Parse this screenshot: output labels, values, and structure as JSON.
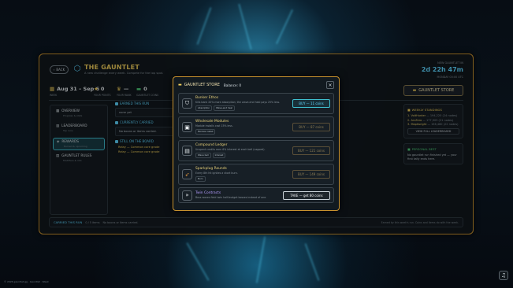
{
  "header": {
    "back_label": "BACK",
    "title": "THE GAUNTLET",
    "subtitle": "A new challenge every week. Compete for the top spot."
  },
  "next": {
    "label": "NEW GAUNTLET IN",
    "countdown": "2d 22h 47m",
    "sub": "MONDAY 00:00 UTC"
  },
  "stats": [
    {
      "value": "Aug 31 – Sep 6",
      "label": "WEEK",
      "icon": "calendar-icon"
    },
    {
      "value": "0",
      "label": "YOUR POINTS",
      "icon": "star-icon"
    },
    {
      "value": "—",
      "label": "YOUR RANK",
      "icon": "trophy-icon"
    },
    {
      "value": "0",
      "label": "GAUNTLET COINS",
      "icon": "coins-icon"
    }
  ],
  "store_button": "GAUNTLET STORE",
  "sidenav": [
    {
      "label": "OVERVIEW",
      "sub": "Progress & stats",
      "icon": "grid-icon",
      "active": false
    },
    {
      "label": "LEADERBOARD",
      "sub": "Top runs",
      "icon": "podium-icon",
      "active": false
    },
    {
      "label": "REWARDS",
      "sub": "Earned & upcoming",
      "icon": "gift-icon",
      "active": true
    },
    {
      "label": "GAUNTLET RULES",
      "sub": "Modifiers & info",
      "icon": "book-icon",
      "active": false
    }
  ],
  "middle": {
    "earned_h": "EARNED THIS RUN",
    "earned_val": "none yet",
    "carried_h": "CURRENTLY CARRIED",
    "carried_val": "No boons or items carried.",
    "board_h": "STILL ON THE BOARD",
    "board_rows": [
      "Relay — Common core grade",
      "Relay — Common core grade"
    ]
  },
  "right": {
    "standings_h": "WEEKLY STANDINGS",
    "standings": [
      {
        "rank": "1.",
        "name": "VoltHunter",
        "detail": "— 194,220 (24 nodes)"
      },
      {
        "rank": "2.",
        "name": "ArcZero",
        "detail": "— 177,905 (21 nodes)"
      },
      {
        "rank": "3.",
        "name": "Maptwright",
        "detail": "— 156,480 (22 nodes)"
      }
    ],
    "lb_button": "VIEW FULL LEADERBOARD",
    "pb_h": "PERSONAL BEST",
    "pb_text": "No gauntlet run finished yet — your first tally ends here."
  },
  "footer": {
    "h": "CARRIED THIS RUN",
    "meta": "0 / 5 items",
    "msg": "No boons or items carried.",
    "right": "Earned by this week's run. Coins and items do with the week."
  },
  "modal": {
    "title": "GAUNTLET STORE",
    "balance": "Balance: 0",
    "items": [
      {
        "icon": "shield-icon",
        "name": "Bunker Ethos",
        "desc": "Kills bank 20% more absorption; the wave-end heal pays 25% less.",
        "tags": [
          "Absorption",
          "Wave-end heal"
        ],
        "action": "BUY — 11 coins",
        "kind": "buy-active"
      },
      {
        "icon": "chip-icon",
        "name": "Wholesale Modules",
        "desc": "Module installs cost 15% less.",
        "tags": [
          "Module install"
        ],
        "action": "BUY — 87 coins",
        "kind": "buy"
      },
      {
        "icon": "ledger-icon",
        "name": "Compound Ledger",
        "desc": "Unspent credits earn 6% interest at each bell (capped).",
        "tags": [
          "Wave bell",
          "Interest"
        ],
        "action": "BUY — 121 coins",
        "kind": "buy"
      },
      {
        "icon": "rocket-icon",
        "name": "Sparkplug Rounds",
        "desc": "Every 8th hit ignites a short burn.",
        "tags": [
          "Burn"
        ],
        "action": "BUY — 149 coins",
        "kind": "buy"
      },
      {
        "icon": "chevrons-icon",
        "name": "Twin Contracts",
        "desc": "Boss waves field twin half-budget bosses instead of one.",
        "tags": [],
        "action": "TAKE — get 80 coins",
        "kind": "take"
      }
    ]
  },
  "bottom_left": "© 2026 gauntlet.gg  ·  Gauntlet  ·  Week"
}
